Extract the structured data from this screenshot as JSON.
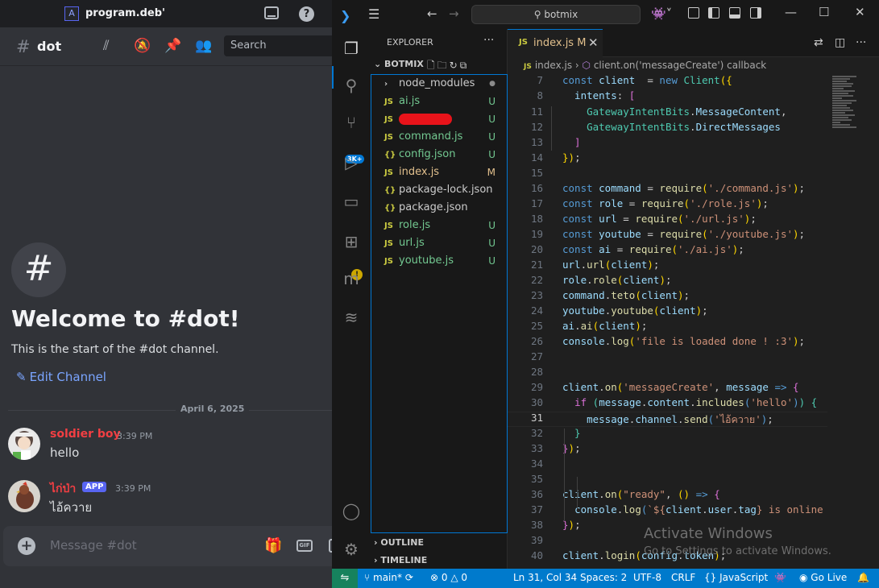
{
  "discord": {
    "window_title": "program.deb'",
    "channel_name": "dot",
    "search_placeholder": "Search",
    "welcome_title": "Welcome to #dot!",
    "welcome_subtitle": "This is the start of the #dot channel.",
    "edit_channel": "Edit Channel",
    "date_divider": "April 6, 2025",
    "messages": [
      {
        "author": "soldier boy",
        "time": "3:39 PM",
        "text": "hello",
        "color": "#f23f43"
      },
      {
        "author": "ไก่ป่า",
        "badge": "APP",
        "time": "3:39 PM",
        "text": "ไอ้ควาย",
        "color": "#f23f43"
      }
    ],
    "composer_placeholder": "Message #dot",
    "gif_label": "GIF"
  },
  "vscode": {
    "search_text": "botmix",
    "explorer_title": "EXPLORER",
    "folder_name": "BOTMIX",
    "scm_badge": "3K+",
    "files": [
      {
        "icon": "folder",
        "name": "node_modules",
        "status": "●",
        "color": "#cccccc"
      },
      {
        "icon": "js",
        "name": "ai.js",
        "status": "U",
        "color": "#73c991"
      },
      {
        "icon": "js",
        "name": "",
        "status": "U",
        "color": "#73c991",
        "redacted": true
      },
      {
        "icon": "js",
        "name": "command.js",
        "status": "U",
        "color": "#73c991"
      },
      {
        "icon": "json",
        "name": "config.json",
        "status": "U",
        "color": "#73c991"
      },
      {
        "icon": "js",
        "name": "index.js",
        "status": "M",
        "color": "#e2c08d"
      },
      {
        "icon": "json",
        "name": "package-lock.json",
        "status": "",
        "color": "#cccccc"
      },
      {
        "icon": "json",
        "name": "package.json",
        "status": "",
        "color": "#cccccc"
      },
      {
        "icon": "js",
        "name": "role.js",
        "status": "U",
        "color": "#73c991"
      },
      {
        "icon": "js",
        "name": "url.js",
        "status": "U",
        "color": "#73c991"
      },
      {
        "icon": "js",
        "name": "youtube.js",
        "status": "U",
        "color": "#73c991"
      }
    ],
    "outline_label": "OUTLINE",
    "timeline_label": "TIMELINE",
    "tab": {
      "name": "index.js",
      "status": "M"
    },
    "breadcrumb": {
      "file": "index.js",
      "symbol": "client.on('messageCreate') callback"
    },
    "current_line": 31,
    "watermark": {
      "title": "Activate Windows",
      "subtitle": "Go to Settings to activate Windows."
    },
    "statusbar": {
      "branch": "main*",
      "problems": "0",
      "warnings": "0",
      "position": "Ln 31, Col 34",
      "spaces": "Spaces: 2",
      "encoding": "UTF-8",
      "eol": "CRLF",
      "language": "JavaScript",
      "golive": "Go Live"
    }
  },
  "code_lines": [
    {
      "n": 7,
      "segs": [
        [
          "k",
          "const "
        ],
        [
          "v",
          "client"
        ],
        [
          "",
          "  = "
        ],
        [
          "k",
          "new "
        ],
        [
          "c",
          "Client"
        ],
        [
          "y",
          "({"
        ]
      ]
    },
    {
      "n": 8,
      "segs": [
        [
          "v",
          "  intents"
        ],
        [
          "",
          ": "
        ],
        [
          "p",
          "["
        ]
      ]
    },
    {
      "n": 11,
      "segs": [
        [
          "",
          "    "
        ],
        [
          "c",
          "GatewayIntentBits"
        ],
        [
          "",
          "."
        ],
        [
          "v",
          "MessageContent"
        ],
        [
          "",
          ","
        ]
      ]
    },
    {
      "n": 12,
      "segs": [
        [
          "",
          "    "
        ],
        [
          "c",
          "GatewayIntentBits"
        ],
        [
          "",
          "."
        ],
        [
          "v",
          "DirectMessages"
        ]
      ]
    },
    {
      "n": 13,
      "segs": [
        [
          "p",
          "  ]"
        ]
      ]
    },
    {
      "n": 14,
      "segs": [
        [
          "y",
          "})"
        ],
        [
          "",
          ";"
        ]
      ]
    },
    {
      "n": 15,
      "segs": []
    },
    {
      "n": 16,
      "segs": [
        [
          "k",
          "const "
        ],
        [
          "v",
          "command"
        ],
        [
          "",
          " = "
        ],
        [
          "f",
          "require"
        ],
        [
          "y",
          "("
        ],
        [
          "s",
          "'./command.js'"
        ],
        [
          "y",
          ")"
        ],
        [
          "",
          ";"
        ]
      ]
    },
    {
      "n": 17,
      "segs": [
        [
          "k",
          "const "
        ],
        [
          "v",
          "role"
        ],
        [
          "",
          " = "
        ],
        [
          "f",
          "require"
        ],
        [
          "y",
          "("
        ],
        [
          "s",
          "'./role.js'"
        ],
        [
          "y",
          ")"
        ],
        [
          "",
          ";"
        ]
      ]
    },
    {
      "n": 18,
      "segs": [
        [
          "k",
          "const "
        ],
        [
          "v",
          "url"
        ],
        [
          "",
          " = "
        ],
        [
          "f",
          "require"
        ],
        [
          "y",
          "("
        ],
        [
          "s",
          "'./url.js'"
        ],
        [
          "y",
          ")"
        ],
        [
          "",
          ";"
        ]
      ]
    },
    {
      "n": 19,
      "segs": [
        [
          "k",
          "const "
        ],
        [
          "v",
          "youtube"
        ],
        [
          "",
          " = "
        ],
        [
          "f",
          "require"
        ],
        [
          "y",
          "("
        ],
        [
          "s",
          "'./youtube.js'"
        ],
        [
          "y",
          ")"
        ],
        [
          "",
          ";"
        ]
      ]
    },
    {
      "n": 20,
      "segs": [
        [
          "k",
          "const "
        ],
        [
          "v",
          "ai"
        ],
        [
          "",
          " = "
        ],
        [
          "f",
          "require"
        ],
        [
          "y",
          "("
        ],
        [
          "s",
          "'./ai.js'"
        ],
        [
          "y",
          ")"
        ],
        [
          "",
          ";"
        ]
      ]
    },
    {
      "n": 21,
      "segs": [
        [
          "v",
          "url"
        ],
        [
          "",
          "."
        ],
        [
          "f",
          "url"
        ],
        [
          "y",
          "("
        ],
        [
          "v",
          "client"
        ],
        [
          "y",
          ")"
        ],
        [
          "",
          ";"
        ]
      ]
    },
    {
      "n": 22,
      "segs": [
        [
          "v",
          "role"
        ],
        [
          "",
          "."
        ],
        [
          "f",
          "role"
        ],
        [
          "y",
          "("
        ],
        [
          "v",
          "client"
        ],
        [
          "y",
          ")"
        ],
        [
          "",
          ";"
        ]
      ]
    },
    {
      "n": 23,
      "segs": [
        [
          "v",
          "command"
        ],
        [
          "",
          "."
        ],
        [
          "f",
          "teto"
        ],
        [
          "y",
          "("
        ],
        [
          "v",
          "client"
        ],
        [
          "y",
          ")"
        ],
        [
          "",
          ";"
        ]
      ]
    },
    {
      "n": 24,
      "segs": [
        [
          "v",
          "youtube"
        ],
        [
          "",
          "."
        ],
        [
          "f",
          "youtube"
        ],
        [
          "y",
          "("
        ],
        [
          "v",
          "client"
        ],
        [
          "y",
          ")"
        ],
        [
          "",
          ";"
        ]
      ]
    },
    {
      "n": 25,
      "segs": [
        [
          "v",
          "ai"
        ],
        [
          "",
          "."
        ],
        [
          "f",
          "ai"
        ],
        [
          "y",
          "("
        ],
        [
          "v",
          "client"
        ],
        [
          "y",
          ")"
        ],
        [
          "",
          ";"
        ]
      ]
    },
    {
      "n": 26,
      "segs": [
        [
          "v",
          "console"
        ],
        [
          "",
          "."
        ],
        [
          "f",
          "log"
        ],
        [
          "y",
          "("
        ],
        [
          "s",
          "'file is loaded done ! :3'"
        ],
        [
          "y",
          ")"
        ],
        [
          "",
          ";"
        ]
      ]
    },
    {
      "n": 27,
      "segs": []
    },
    {
      "n": 28,
      "segs": []
    },
    {
      "n": 29,
      "segs": [
        [
          "v",
          "client"
        ],
        [
          "",
          "."
        ],
        [
          "f",
          "on"
        ],
        [
          "y",
          "("
        ],
        [
          "s",
          "'messageCreate'"
        ],
        [
          "",
          ", "
        ],
        [
          "v",
          "message"
        ],
        [
          "k",
          " =>"
        ],
        [
          "",
          " "
        ],
        [
          "p",
          "{"
        ]
      ]
    },
    {
      "n": 30,
      "segs": [
        [
          "",
          "  "
        ],
        [
          "p",
          "if"
        ],
        [
          "",
          " "
        ],
        [
          "c",
          "("
        ],
        [
          "v",
          "message"
        ],
        [
          "",
          "."
        ],
        [
          "v",
          "content"
        ],
        [
          "",
          "."
        ],
        [
          "f",
          "includes"
        ],
        [
          "k",
          "("
        ],
        [
          "s",
          "'hello'"
        ],
        [
          "k",
          ")"
        ],
        [
          "c",
          ")"
        ],
        [
          "",
          " "
        ],
        [
          "c",
          "{"
        ]
      ]
    },
    {
      "n": 31,
      "segs": [
        [
          "",
          "    "
        ],
        [
          "v",
          "message"
        ],
        [
          "",
          "."
        ],
        [
          "v",
          "channel"
        ],
        [
          "",
          "."
        ],
        [
          "f",
          "send"
        ],
        [
          "k",
          "("
        ],
        [
          "s",
          "'ไอ้ควาย'"
        ],
        [
          "k",
          ")"
        ],
        [
          "",
          ";"
        ]
      ]
    },
    {
      "n": 32,
      "segs": [
        [
          "c",
          "  }"
        ]
      ]
    },
    {
      "n": 33,
      "segs": [
        [
          "p",
          "}"
        ],
        [
          "y",
          ")"
        ],
        [
          "",
          ";"
        ]
      ]
    },
    {
      "n": 34,
      "segs": []
    },
    {
      "n": 35,
      "segs": []
    },
    {
      "n": 36,
      "segs": [
        [
          "v",
          "client"
        ],
        [
          "",
          "."
        ],
        [
          "f",
          "on"
        ],
        [
          "y",
          "("
        ],
        [
          "s",
          "\"ready\""
        ],
        [
          "",
          ", "
        ],
        [
          "y",
          "()"
        ],
        [
          "k",
          " =>"
        ],
        [
          "",
          " "
        ],
        [
          "p",
          "{"
        ]
      ]
    },
    {
      "n": 37,
      "segs": [
        [
          "",
          "  "
        ],
        [
          "v",
          "console"
        ],
        [
          "",
          "."
        ],
        [
          "f",
          "log"
        ],
        [
          "k",
          "("
        ],
        [
          "s",
          "`${"
        ],
        [
          "v",
          "client"
        ],
        [
          "",
          "."
        ],
        [
          "v",
          "user"
        ],
        [
          "",
          "."
        ],
        [
          "v",
          "tag"
        ],
        [
          "s",
          "} is online"
        ]
      ]
    },
    {
      "n": 38,
      "segs": [
        [
          "p",
          "}"
        ],
        [
          "y",
          ")"
        ],
        [
          "",
          ";"
        ]
      ]
    },
    {
      "n": 39,
      "segs": []
    },
    {
      "n": 40,
      "segs": [
        [
          "v",
          "client"
        ],
        [
          "",
          "."
        ],
        [
          "f",
          "login"
        ],
        [
          "y",
          "("
        ],
        [
          "v",
          "config"
        ],
        [
          "",
          "."
        ],
        [
          "v",
          "token"
        ],
        [
          "y",
          ")"
        ],
        [
          "",
          ";"
        ]
      ]
    }
  ]
}
